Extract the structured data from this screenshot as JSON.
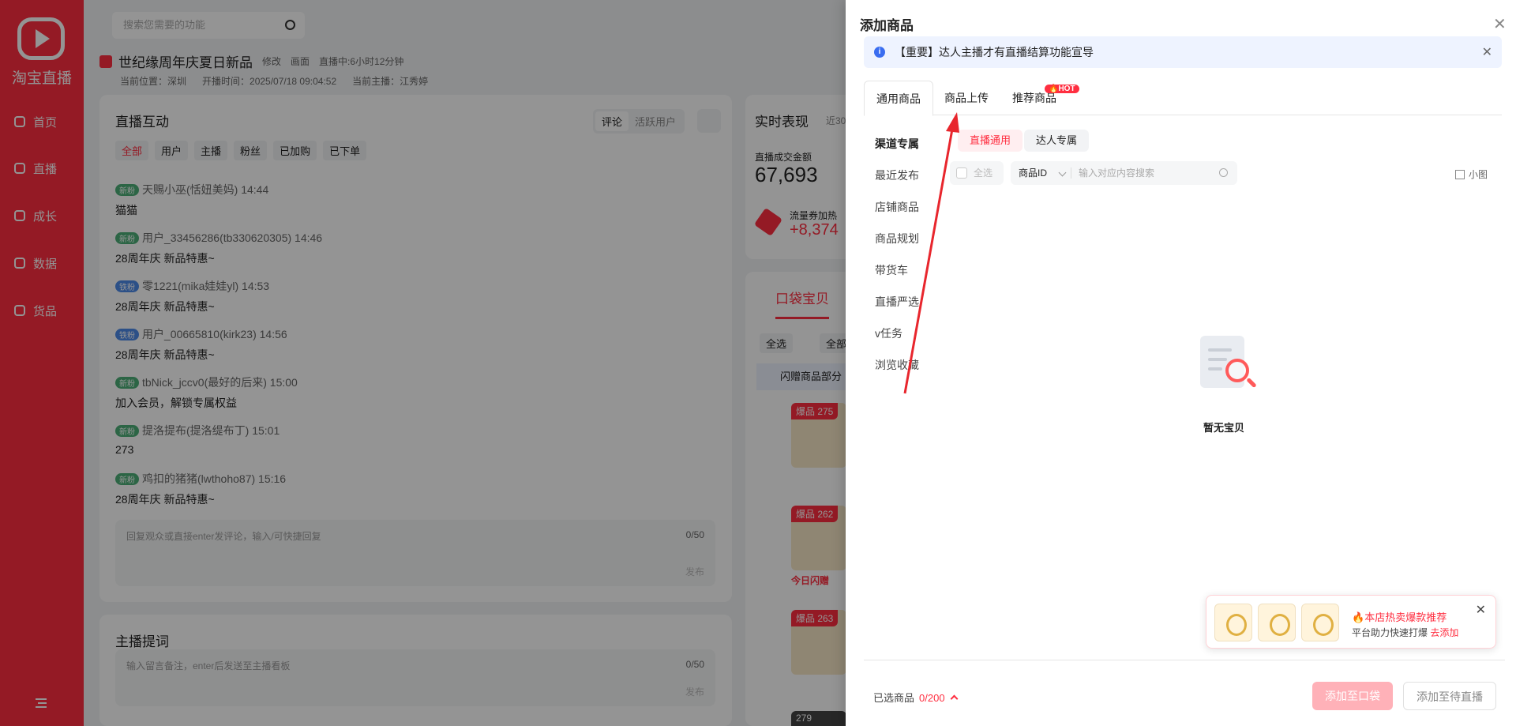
{
  "sidebar": {
    "logo_text": "淘宝直播",
    "items": [
      {
        "label": "首页",
        "icon": "home-icon"
      },
      {
        "label": "直播",
        "icon": "live-icon"
      },
      {
        "label": "成长",
        "icon": "growth-icon"
      },
      {
        "label": "数据",
        "icon": "data-icon"
      },
      {
        "label": "货品",
        "icon": "goods-icon"
      }
    ]
  },
  "header": {
    "search_placeholder": "搜索您需要的功能",
    "live_title": "世纪缘周年庆夏日新品",
    "edit_label": "修改",
    "screen_label": "画面",
    "live_status": "直播中:6小时12分钟",
    "location": "当前位置：深圳",
    "start_time": "开播时间：2025/07/18 09:04:52",
    "anchor": "当前主播：江秀婷"
  },
  "interaction": {
    "title": "直播互动",
    "seg": [
      "评论",
      "活跃用户"
    ],
    "filters": [
      "全部",
      "用户",
      "主播",
      "粉丝",
      "已加购",
      "已下单"
    ],
    "messages": [
      {
        "level": "新粉",
        "user": "天赐小巫(恬妞美妈) 14:44",
        "text": "猫猫"
      },
      {
        "level": "新粉",
        "user": "用户_33456286(tb330620305) 14:46",
        "text": "28周年庆 新品特惠~"
      },
      {
        "level": "铁粉",
        "user": "零1221(mika娃娃yl) 14:53",
        "text": "28周年庆 新品特惠~"
      },
      {
        "level": "铁粉",
        "user": "用户_00665810(kirk23) 14:56",
        "text": "28周年庆 新品特惠~"
      },
      {
        "level": "新粉",
        "user": "tbNick_jccv0(最好的后来) 15:00",
        "text": "加入会员，解锁专属权益"
      },
      {
        "level": "新粉",
        "user": "提洛提布(提洛缇布丁) 15:01",
        "text": "273"
      },
      {
        "level": "新粉",
        "user": "鸡扣的猪猪(lwthoho87) 15:16",
        "text": "28周年庆 新品特惠~"
      }
    ],
    "reply_placeholder": "回复观众或直接enter发评论，输入/可快捷回复",
    "reply_count": "0/50",
    "send_label": "发布"
  },
  "prompter": {
    "title": "主播提词",
    "placeholder": "输入留言备注，enter后发送至主播看板",
    "count": "0/50",
    "send_label": "发布"
  },
  "realtime": {
    "title": "实时表现",
    "note": "近30",
    "gmv_label": "直播成交金额",
    "gmv_value": "67,693",
    "traffic_label": "流量券加热",
    "traffic_value": "+8,374"
  },
  "pocket": {
    "tab": "口袋宝贝",
    "select_all": "全选",
    "all": "全部",
    "notice": "闪赠商品部分",
    "items": [
      {
        "badge": "爆品 275"
      },
      {
        "badge": "爆品 262",
        "flash": "今日闪赠"
      },
      {
        "badge": "爆品 263"
      },
      {
        "badge": "279"
      }
    ]
  },
  "panel": {
    "title": "添加商品",
    "notice": "【重要】达人主播才有直播结算功能宣导",
    "tabs": [
      "通用商品",
      "商品上传",
      "推荐商品"
    ],
    "hot_badge": "HOT",
    "categories": [
      "渠道专属",
      "最近发布",
      "店铺商品",
      "商品规划",
      "带货车",
      "直播严选",
      "v任务",
      "浏览收藏"
    ],
    "subtabs": [
      "直播通用",
      "达人专属"
    ],
    "select_all": "全选",
    "field": "商品ID",
    "search_placeholder": "输入对应内容搜索",
    "view_label": "小图",
    "empty_text": "暂无宝贝",
    "promo_title": "本店热卖爆款推荐",
    "promo_sub": "平台助力快速打爆",
    "promo_link": "去添加",
    "selected_label": "已选商品",
    "selected_count": "0/200",
    "add_pocket": "添加至口袋",
    "add_pending": "添加至待直播"
  },
  "colors": {
    "brand": "#ff2e40",
    "info": "#3a6df0",
    "annotation_arrow": "#e8262d"
  }
}
